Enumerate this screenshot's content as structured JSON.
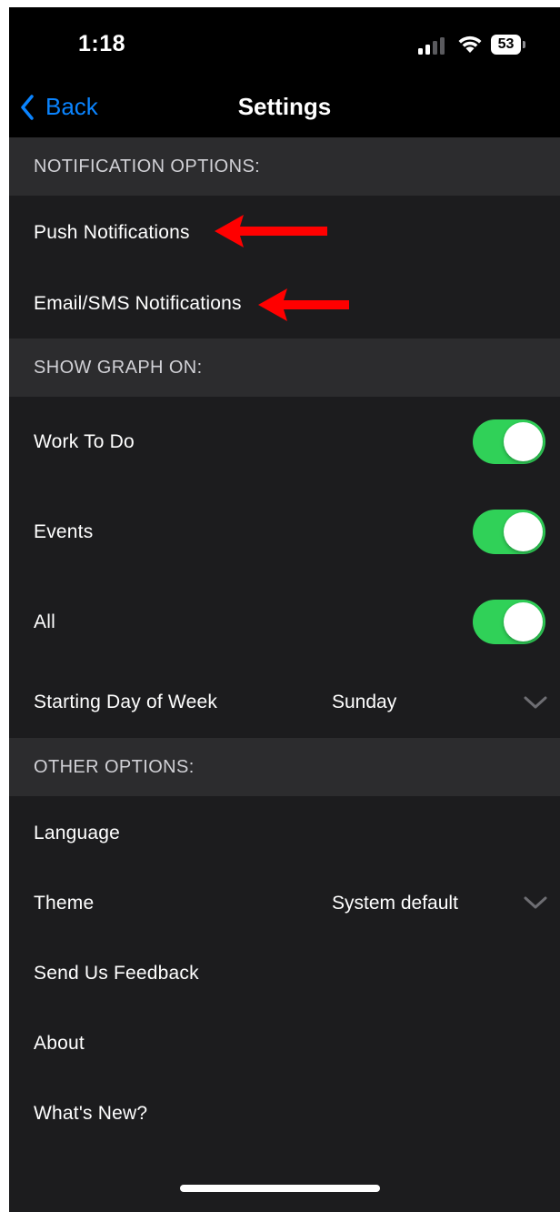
{
  "status_bar": {
    "time": "1:18",
    "battery": "53",
    "signal_icon": "cellular-signal-icon",
    "wifi_icon": "wifi-icon"
  },
  "nav": {
    "back_label": "Back",
    "title": "Settings"
  },
  "sections": {
    "notifications": {
      "header": "NOTIFICATION OPTIONS:",
      "push_label": "Push Notifications",
      "email_sms_label": "Email/SMS Notifications"
    },
    "graph": {
      "header": "SHOW GRAPH ON:",
      "work_to_do_label": "Work To Do",
      "work_to_do_on": true,
      "events_label": "Events",
      "events_on": true,
      "all_label": "All",
      "all_on": true,
      "starting_day_label": "Starting Day of Week",
      "starting_day_value": "Sunday"
    },
    "other": {
      "header": "OTHER OPTIONS:",
      "language_label": "Language",
      "theme_label": "Theme",
      "theme_value": "System default",
      "feedback_label": "Send Us Feedback",
      "about_label": "About",
      "whats_new_label": "What's New?"
    }
  },
  "colors": {
    "accent_blue": "#0a84ff",
    "toggle_green": "#30d158",
    "annotation_red": "#ff0000",
    "background": "#1c1c1e",
    "section_header_bg": "#2c2c2e"
  }
}
